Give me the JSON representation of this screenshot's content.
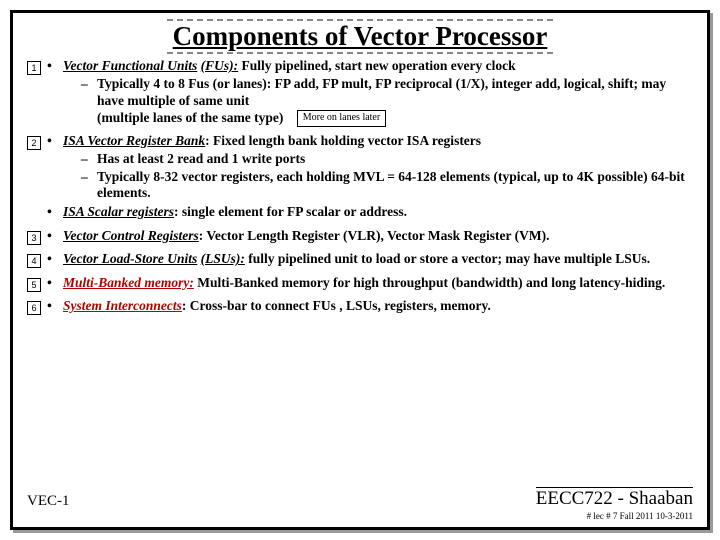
{
  "title": "Components of Vector Processor",
  "items": [
    {
      "num": "1",
      "term": "Vector Functional Units",
      "paren": "(FUs):",
      "rest": " Fully pipelined, start new operation every clock",
      "subs": [
        "Typically 4 to 8 Fus (or lanes): FP add, FP mult, FP reciprocal (1/X), integer add, logical,  shift; may have multiple of same unit"
      ],
      "tail": "(multiple lanes of the same type)",
      "note": "More on lanes later"
    },
    {
      "num": "2",
      "term": "ISA Vector Register Bank",
      "rest": ": Fixed length bank holding vector ISA registers",
      "subs": [
        "Has at least 2 read and 1 write ports",
        "Typically 8-32 vector registers, each holding MVL = 64-128 elements (typical, up to 4K possible)   64-bit elements."
      ],
      "extra_term": "ISA Scalar registers",
      "extra_rest": ": single element for FP scalar or address."
    },
    {
      "num": "3",
      "term": "Vector Control Registers",
      "rest": ": Vector Length Register (VLR), Vector Mask Register (VM)."
    },
    {
      "num": "4",
      "term": "Vector Load-Store Units",
      "paren": "(LSUs):",
      "rest": " fully pipelined unit to load or store a vector; may have multiple LSUs."
    },
    {
      "num": "5",
      "term": "Multi-Banked memory:",
      "rest": "  Multi-Banked memory for high throughput (bandwidth) and long latency-hiding.",
      "red": true
    },
    {
      "num": "6",
      "term": "System Interconnects",
      "rest": ": Cross-bar to connect FUs , LSUs, registers, memory.",
      "red": true
    }
  ],
  "footer": {
    "vec": "VEC-1",
    "course": "EECC722 - Shaaban",
    "meta": "#  lec # 7    Fall 2011   10-3-2011"
  }
}
